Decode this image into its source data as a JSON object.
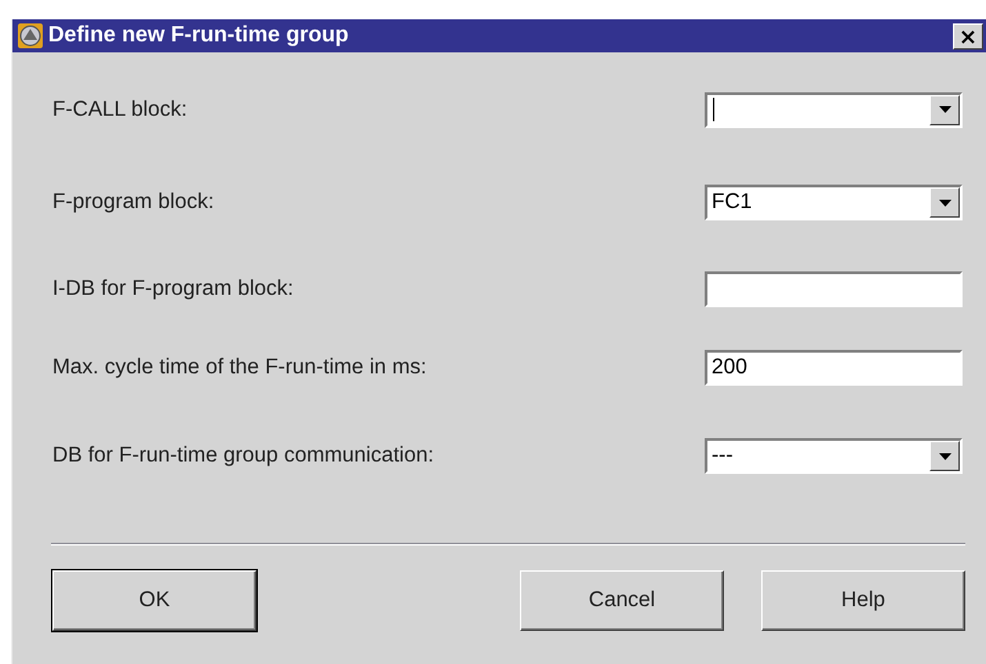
{
  "window": {
    "title": "Define new F-run-time group",
    "close": "×"
  },
  "fields": [
    {
      "label": "F-CALL block:",
      "kind": "combo",
      "focused": true
    },
    {
      "label": "F-program block:",
      "kind": "combo",
      "value": "FC1",
      "focused": false
    },
    {
      "label": "I-DB for F-program block:",
      "kind": "text",
      "focused": false
    },
    {
      "label": "Max. cycle time of the F-run-time in ms:",
      "kind": "text",
      "value": "200",
      "focused": false
    },
    {
      "label": "DB for F-run-time group communication:",
      "kind": "combo",
      "value": "---",
      "focused": false
    }
  ],
  "buttons": [
    {
      "label": "OK",
      "default": true
    },
    {
      "label": "Cancel",
      "default": false
    },
    {
      "label": "Help",
      "default": false
    }
  ]
}
